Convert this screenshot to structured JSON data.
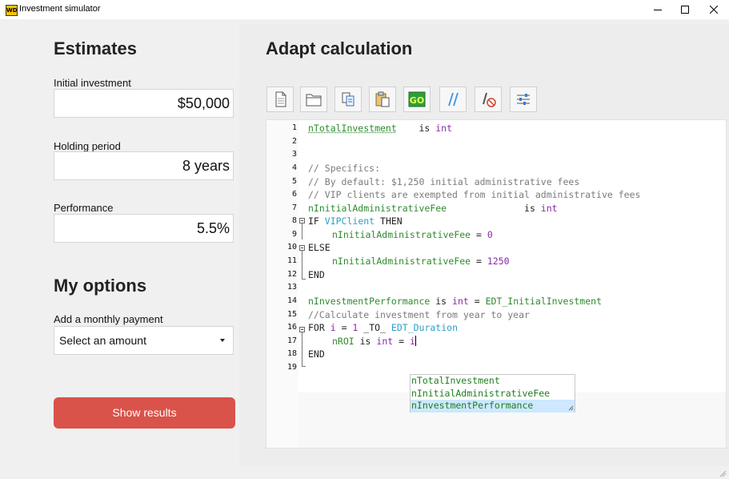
{
  "window": {
    "title": "Investment simulator",
    "icon_text": "WD"
  },
  "estimates": {
    "heading": "Estimates",
    "initial_investment": {
      "label": "Initial investment",
      "value": "$50,000"
    },
    "holding_period": {
      "label": "Holding period",
      "value": "8 years"
    },
    "performance": {
      "label": "Performance",
      "value": "5.5%"
    }
  },
  "options": {
    "heading": "My options",
    "monthly_payment": {
      "label": "Add a monthly payment",
      "selected": "Select an amount"
    }
  },
  "show_results_label": "Show results",
  "editor": {
    "heading": "Adapt calculation",
    "toolbar": [
      "new-document-icon",
      "open-folder-icon",
      "copy-icon",
      "paste-icon",
      "go-icon",
      "comment-icon",
      "no-comment-icon",
      "settings-sliders-icon"
    ],
    "line_numbers": [
      "1",
      "2",
      "3",
      "4",
      "5",
      "6",
      "7",
      "8",
      "9",
      "10",
      "11",
      "12",
      "13",
      "14",
      "15",
      "16",
      "17",
      "18",
      "19"
    ],
    "code": {
      "l1_var": "nTotalInvestment",
      "l1_is": "    is ",
      "l1_type": "int",
      "l4": "// Specifics:",
      "l5": "// By default: $1,250 initial administrative fees",
      "l6": "// VIP clients are exempted from initial administrative fees",
      "l7_var": "nInitialAdministrativeFee",
      "l7_is": "              is ",
      "l7_type": "int",
      "l8_kw": "IF ",
      "l8_var": "VIPClient",
      "l8_then": " THEN",
      "l9_var": "nInitialAdministrativeFee",
      "l9_eq": " = ",
      "l9_num": "0",
      "l10": "ELSE",
      "l11_var": "nInitialAdministrativeFee",
      "l11_eq": " = ",
      "l11_num": "1250",
      "l12": "END",
      "l14_var": "nInvestmentPerformance",
      "l14_is": " is ",
      "l14_type": "int",
      "l14_eq": " = ",
      "l14_ctrl": "EDT_InitialInvestment",
      "l15": "//Calculate investment from year to year",
      "l16_for": "FOR ",
      "l16_i": "i",
      "l16_eq": " = ",
      "l16_one": "1",
      "l16_to": " _TO_ ",
      "l16_ctrl": "EDT_Duration",
      "l17_var": "nROI",
      "l17_is": " is ",
      "l17_type": "int",
      "l17_eq": " = ",
      "l17_i": "i",
      "l18": "END"
    },
    "autocomplete": [
      "nTotalInvestment",
      "nInitialAdministrativeFee",
      "nInvestmentPerformance"
    ]
  }
}
